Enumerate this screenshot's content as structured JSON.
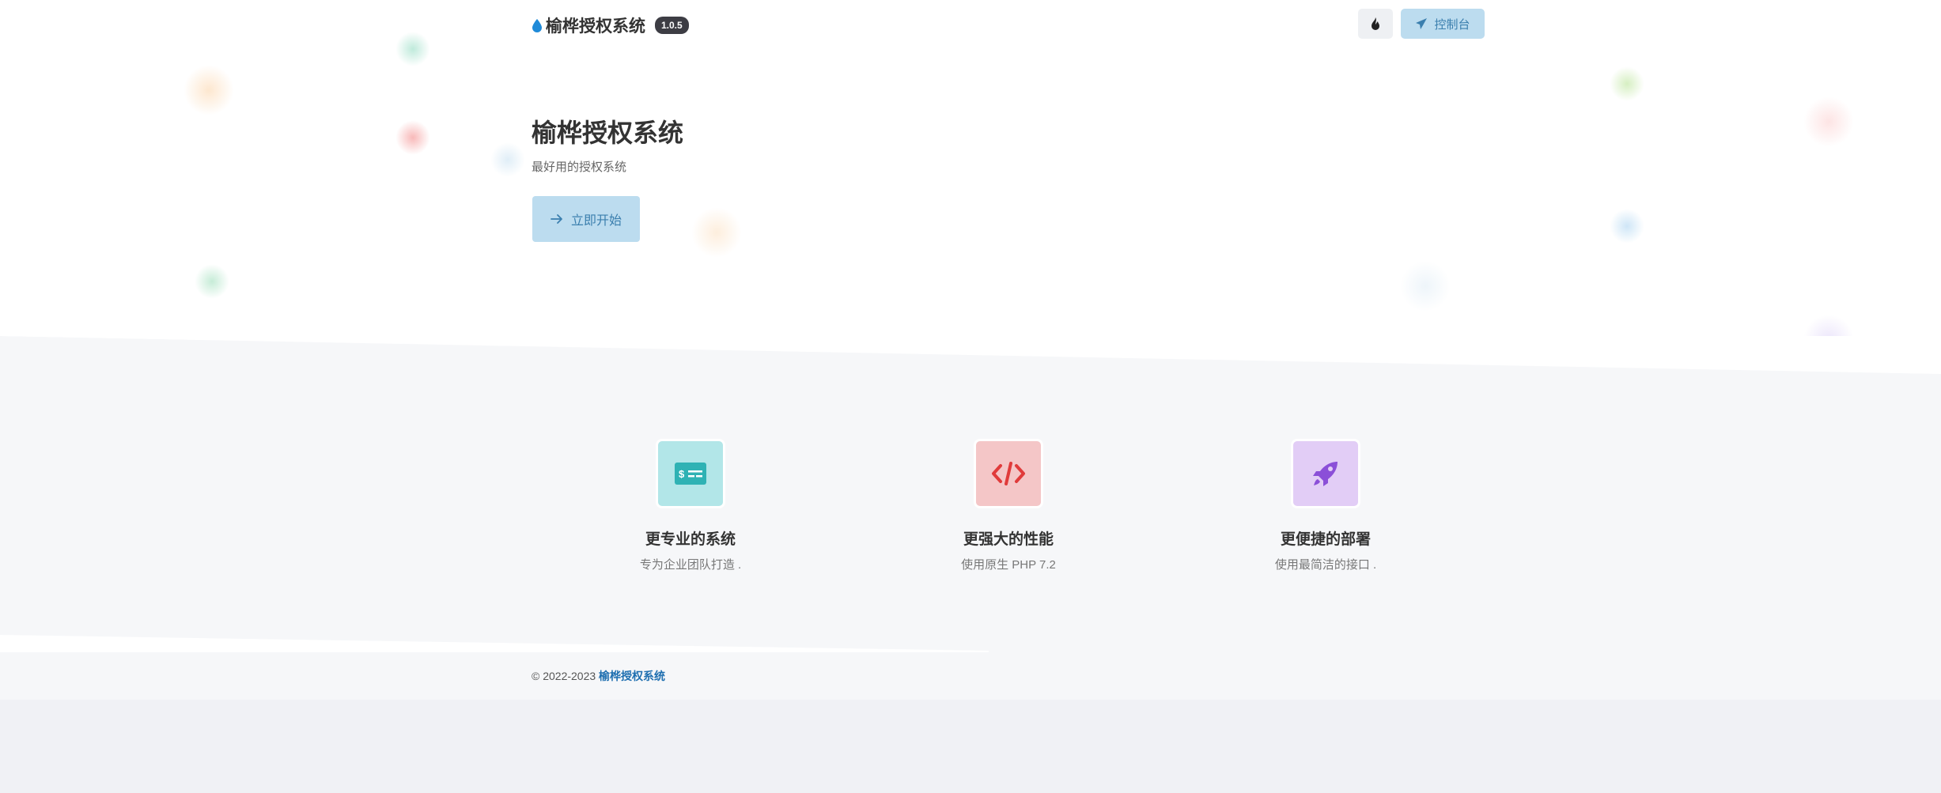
{
  "header": {
    "site_title": "榆桦授权系统",
    "version": "1.0.5",
    "console_label": "控制台"
  },
  "hero": {
    "title": "榆桦授权系统",
    "subtitle": "最好用的授权系统",
    "start_label": "立即开始"
  },
  "features": [
    {
      "title": "更专业的系统",
      "desc": "专为企业团队打造 .",
      "icon": "license-card-icon",
      "bg": "#b2e6e8",
      "fg": "#2fb2b4"
    },
    {
      "title": "更强大的性能",
      "desc": "使用原生 PHP 7.2",
      "icon": "code-icon",
      "bg": "#f4c6c7",
      "fg": "#e03b3b"
    },
    {
      "title": "更便捷的部署",
      "desc": "使用最简洁的接口 .",
      "icon": "rocket-icon",
      "bg": "#e2cdf6",
      "fg": "#8b4fd8"
    }
  ],
  "footer": {
    "copyright": "© 2022-2023",
    "link_label": "榆桦授权系统"
  },
  "colors": {
    "accent": "#bcdcef",
    "accent_text": "#3b7fae",
    "link": "#1f6fb0",
    "badge": "#3d3d44"
  }
}
